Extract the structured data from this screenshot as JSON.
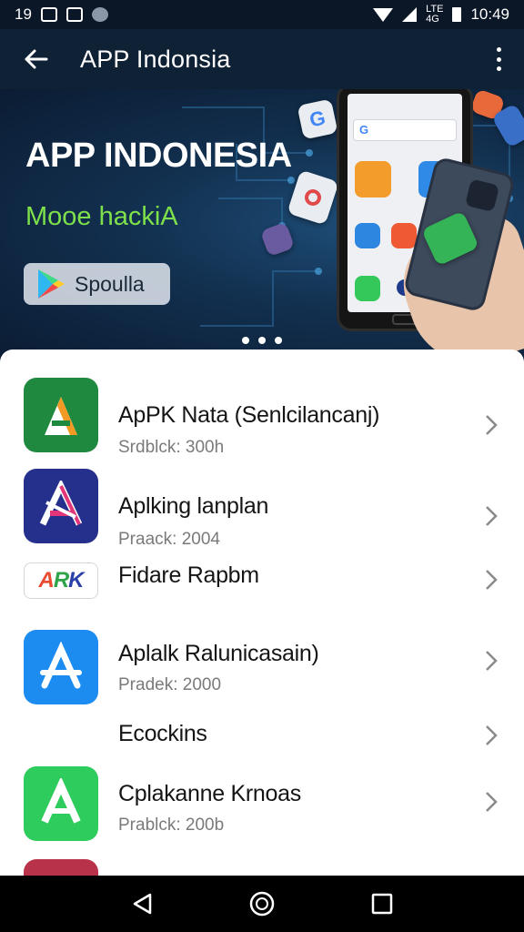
{
  "status_bar": {
    "time_left": "19",
    "time_right": "10:49",
    "net_label": "LTE",
    "net_label2": "4G"
  },
  "app_bar": {
    "title": "APP Indonsia"
  },
  "banner": {
    "title": "APP INDONESIA",
    "subtitle": "Mooe hackiA",
    "button_label": "Spoulla",
    "page_indicator": {
      "count": 3,
      "active": 0
    },
    "accent_color": "#7ee04a"
  },
  "list": [
    {
      "title": "ApPK Nata (Senlcilancanj)",
      "subtitle": "Srdblck: 300h",
      "icon": "apk-a-icon",
      "icon_color": "#1f8a3f"
    },
    {
      "title": "Aplking lanplan",
      "subtitle": "Praack: 2004",
      "icon": "triangle-logo-icon",
      "icon_color": "#25308c"
    },
    {
      "title": "Fidare Rapbm",
      "subtitle": "",
      "icon": "ark-logo-icon",
      "icon_color": "#ffffff"
    },
    {
      "title": "Aplalk Ralunicasain)",
      "subtitle": "Pradek: 2000",
      "icon": "app-store-icon",
      "icon_color": "#1d8cf0"
    },
    {
      "title": "Ecockins",
      "subtitle": "",
      "icon": "",
      "icon_color": ""
    },
    {
      "title": "Cplakanne Krnoas",
      "subtitle": "Prablck: 200b",
      "icon": "green-a-icon",
      "icon_color": "#2dcc5c"
    }
  ],
  "nav_bar": {
    "back": "back-icon",
    "home": "home-icon",
    "recents": "recents-icon"
  }
}
